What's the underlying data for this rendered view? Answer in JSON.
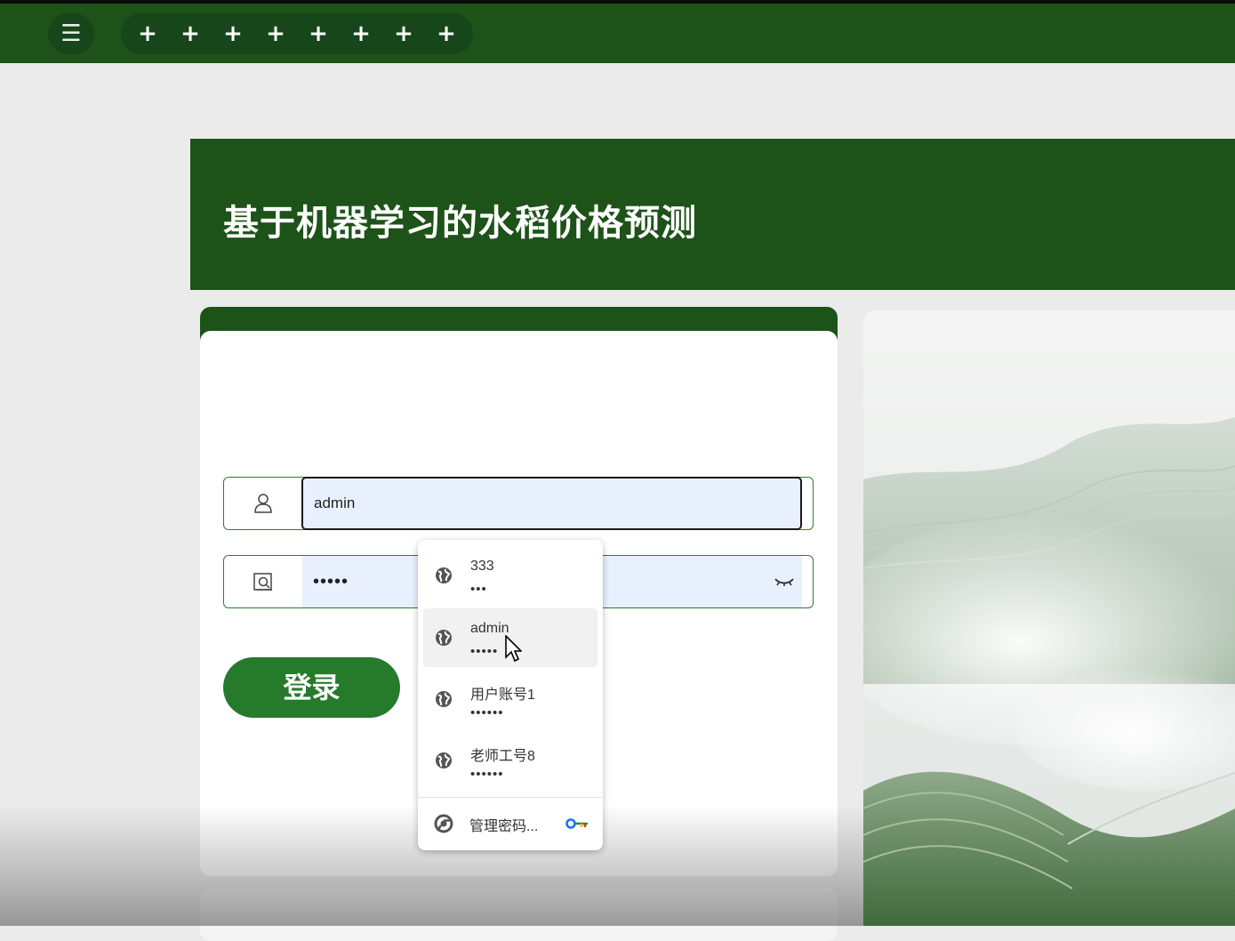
{
  "topbar": {
    "menu_glyph": "☰",
    "plus_buttons": [
      "+",
      "+",
      "+",
      "+",
      "+",
      "+",
      "+",
      "+"
    ]
  },
  "banner": {
    "title": "基于机器学习的水稻价格预测"
  },
  "login": {
    "username_value": "admin",
    "password_value": "•••••",
    "submit_label": "登录"
  },
  "autofill": {
    "entries": [
      {
        "username": "333",
        "password": "•••"
      },
      {
        "username": "admin",
        "password": "•••••"
      },
      {
        "username": "用户账号1",
        "password": "••••••"
      },
      {
        "username": "老师工号8",
        "password": "••••••"
      }
    ],
    "manage_label": "管理密码..."
  },
  "colors": {
    "brand_green": "#1d5218",
    "button_green": "#267a2b",
    "autofill_bg": "#e8f0fe"
  },
  "icons": {
    "menu": "hamburger-icon",
    "plus": "plus-icon",
    "user": "user-icon",
    "password": "lock-frame-icon",
    "eye": "eye-closed-icon",
    "site": "globe-icon",
    "chrome": "chrome-icon",
    "key": "key-icon"
  }
}
